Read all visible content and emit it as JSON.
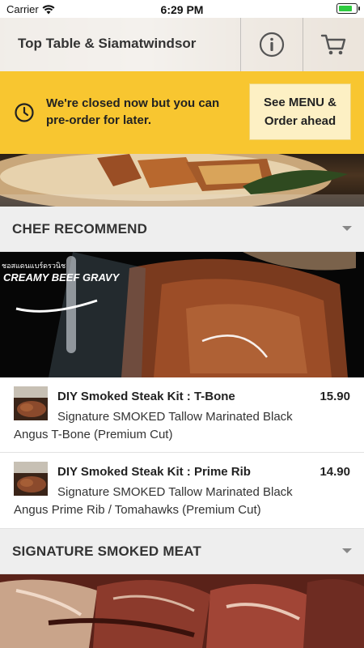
{
  "status_bar": {
    "carrier": "Carrier",
    "time": "6:29 PM"
  },
  "header": {
    "title": "Top Table & Siamatwindsor",
    "info_icon": "info-icon",
    "cart_icon": "cart-icon"
  },
  "banner": {
    "message": "We're closed now but you can pre-order for later.",
    "button_label": "See MENU & Order ahead",
    "accent_color": "#f8c630"
  },
  "categories": [
    {
      "label": "CHEF RECOMMEND",
      "items": [
        {
          "name": "DIY Smoked Steak Kit : T-Bone",
          "price": "15.90",
          "description": "Signature SMOKED Tallow Marinated Black Angus T-Bone (Premium Cut)"
        },
        {
          "name": "DIY Smoked Steak Kit : Prime Rib",
          "price": "14.90",
          "description": "Signature SMOKED Tallow Marinated Black Angus Prime Rib / Tomahawks (Premium Cut)"
        }
      ],
      "image_caption": "CREAMY BEEF GRAVY"
    },
    {
      "label": "SIGNATURE SMOKED MEAT"
    }
  ]
}
